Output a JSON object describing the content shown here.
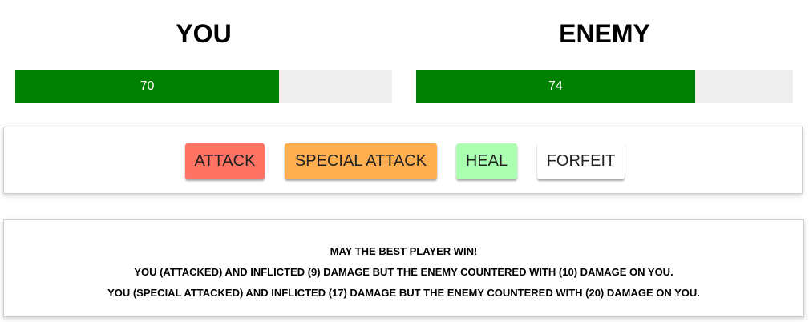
{
  "player": {
    "title": "YOU",
    "health": 70,
    "health_label": "70"
  },
  "enemy": {
    "title": "ENEMY",
    "health": 74,
    "health_label": "74"
  },
  "controls": {
    "attack_label": "ATTACK",
    "special_attack_label": "SPECIAL ATTACK",
    "heal_label": "HEAL",
    "forfeit_label": "FORFEIT"
  },
  "log": {
    "entries": [
      "MAY THE BEST PLAYER WIN!",
      "YOU (ATTACKED) AND INFLICTED (9) DAMAGE BUT THE ENEMY COUNTERED WITH (10) DAMAGE ON YOU.",
      "YOU (SPECIAL ATTACKED) AND INFLICTED (17) DAMAGE BUT THE ENEMY COUNTERED WITH (20) DAMAGE ON YOU."
    ]
  },
  "colors": {
    "health_fill": "#008000",
    "health_track": "#eeeeee",
    "attack": "#ff7364",
    "special_attack": "#ffaf4f",
    "heal": "#aaffb0",
    "forfeit": "#ffffff"
  }
}
